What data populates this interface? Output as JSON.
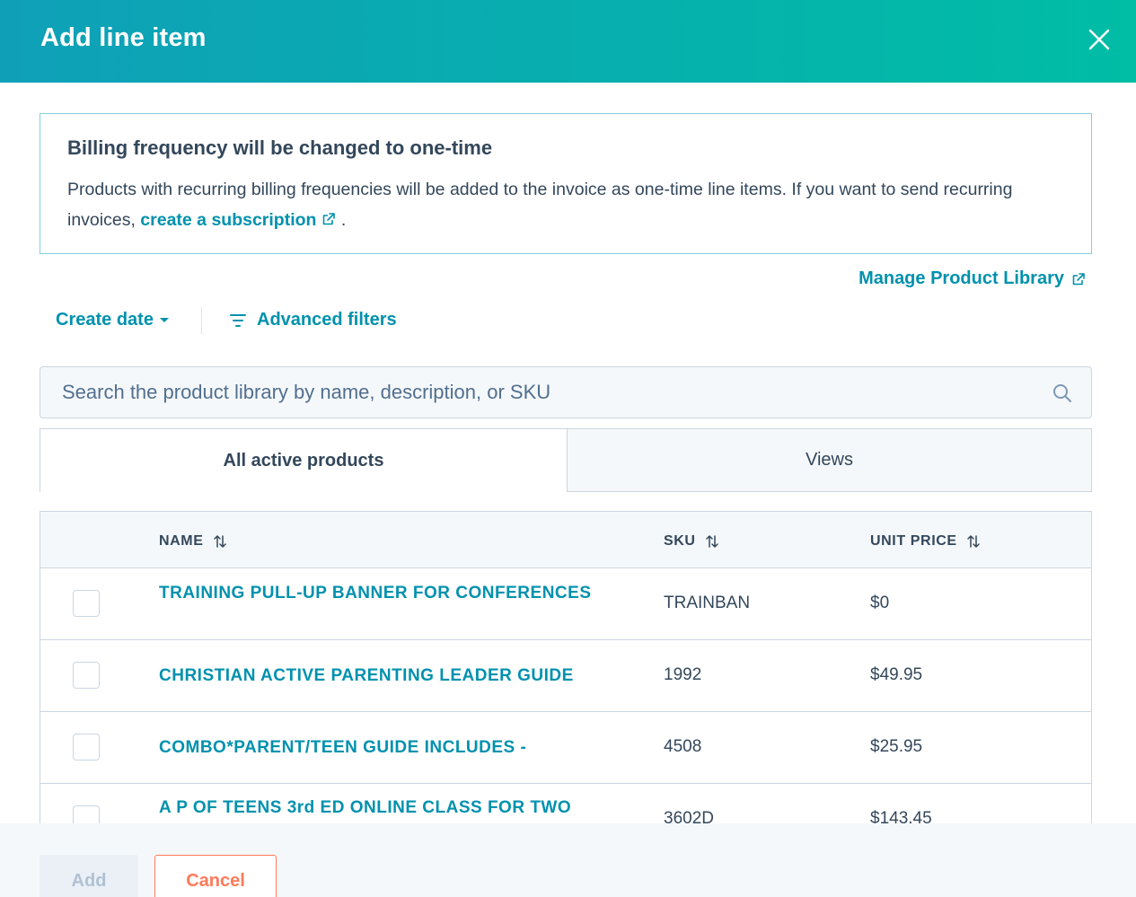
{
  "modal": {
    "title": "Add line item"
  },
  "notice": {
    "title": "Billing frequency will be changed to one-time",
    "body_text": "Products with recurring billing frequencies will be added to the invoice as one-time line items. If you want to send recurring invoices,",
    "link_text": "create a subscription",
    "trailing": "."
  },
  "manage_link": "Manage Product Library",
  "filters": {
    "create_date": "Create date",
    "advanced": "Advanced filters"
  },
  "search": {
    "placeholder": "Search the product library by name, description, or SKU",
    "value": ""
  },
  "tabs": [
    {
      "label": "All active products",
      "active": true
    },
    {
      "label": "Views",
      "active": false
    }
  ],
  "table": {
    "columns": [
      {
        "label": "NAME"
      },
      {
        "label": "SKU"
      },
      {
        "label": "UNIT PRICE"
      }
    ],
    "rows": [
      {
        "name": "TRAINING PULL-UP BANNER FOR CONFERENCES",
        "sku": "TRAINBAN",
        "price": "$0",
        "checked": false
      },
      {
        "name": "CHRISTIAN ACTIVE PARENTING LEADER GUIDE",
        "sku": "1992",
        "price": "$49.95",
        "checked": false
      },
      {
        "name": "COMBO*PARENT/TEEN GUIDE INCLUDES -",
        "sku": "4508",
        "price": "$25.95",
        "checked": false
      },
      {
        "name": "A P OF TEENS 3rd ED ONLINE CLASS FOR TWO",
        "sku": "3602D",
        "price": "$143.45",
        "checked": false
      }
    ]
  },
  "footer": {
    "add_label": "Add",
    "cancel_label": "Cancel"
  },
  "colors": {
    "header_gradient_start": "#0fa0b8",
    "header_gradient_end": "#00bda5",
    "link": "#0091ae",
    "cancel": "#ff7a59",
    "text": "#33475b"
  }
}
